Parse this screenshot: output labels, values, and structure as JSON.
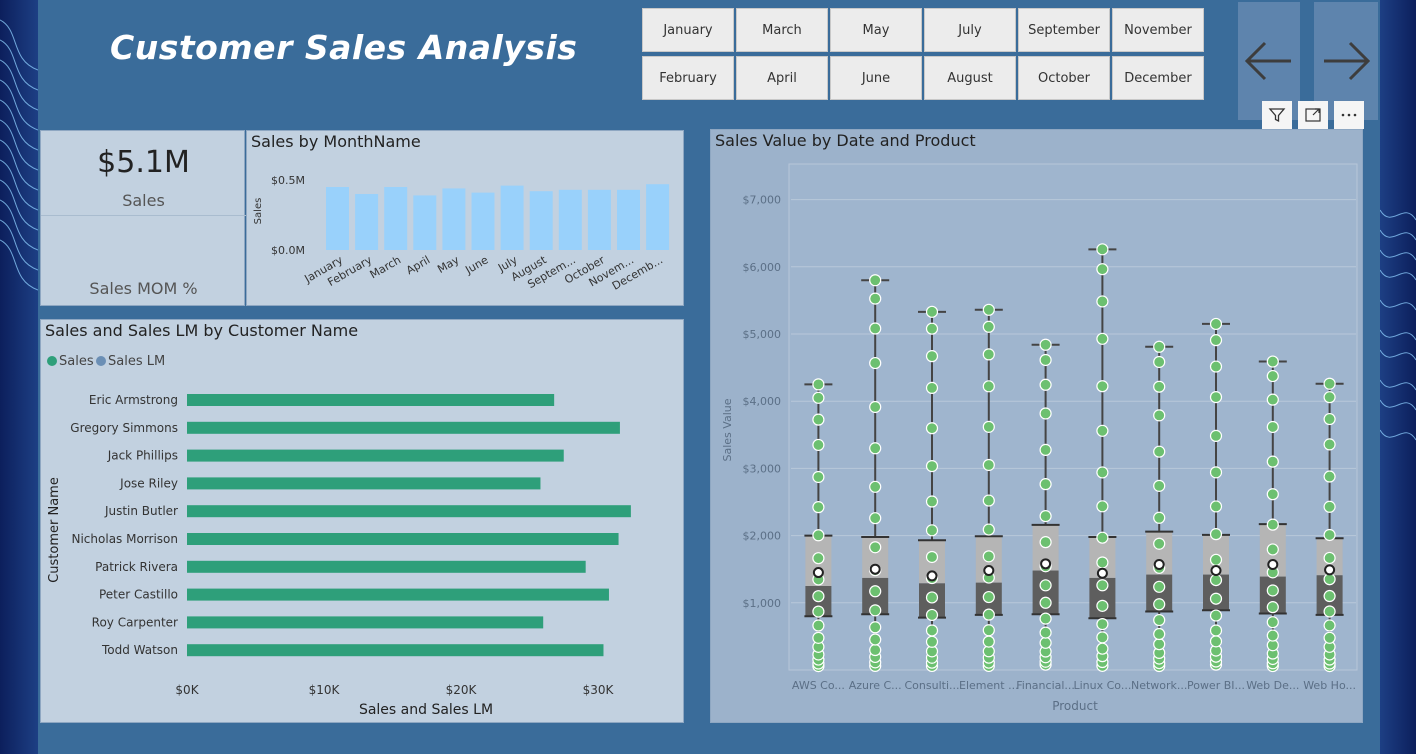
{
  "report": {
    "title": "Customer Sales Analysis"
  },
  "month_slicer": {
    "row1": [
      "January",
      "March",
      "May",
      "July",
      "September",
      "November"
    ],
    "row2": [
      "February",
      "April",
      "June",
      "August",
      "October",
      "December"
    ]
  },
  "navigation": {
    "prev_icon": "arrow-left-icon",
    "next_icon": "arrow-right-icon"
  },
  "visual_header_icons": [
    "filter-icon",
    "focus-mode-icon",
    "more-options-icon"
  ],
  "kpi_card": {
    "value": "$5.1M",
    "label": "Sales",
    "secondary_label": "Sales MOM %"
  },
  "colors": {
    "page_bg": "#3a6c9a",
    "panel_bg": "#c2d1e0",
    "month_bar": "#99d1fb",
    "sales_bar": "#2e9f7a",
    "sales_lm": "#6b8fb5",
    "box_dot": "#6cc070"
  },
  "charts": [
    {
      "id": "sales-by-month",
      "chart_data": {
        "type": "bar",
        "title": "Sales by MonthName",
        "ylabel": "Sales",
        "xlabel": "",
        "yticks": [
          "$0.0M",
          "$0.5M"
        ],
        "ylim": [
          0,
          0.5
        ],
        "categories": [
          "January",
          "February",
          "March",
          "April",
          "May",
          "June",
          "July",
          "August",
          "Septem...",
          "October",
          "Novem...",
          "Decemb..."
        ],
        "values": [
          0.45,
          0.4,
          0.45,
          0.39,
          0.44,
          0.41,
          0.46,
          0.42,
          0.43,
          0.43,
          0.43,
          0.47
        ]
      }
    },
    {
      "id": "sales-by-customer",
      "chart_data": {
        "type": "bar",
        "orientation": "horizontal",
        "title": "Sales and Sales LM by Customer Name",
        "xlabel": "Sales and Sales LM",
        "ylabel": "Customer Name",
        "legend": [
          "Sales",
          "Sales LM"
        ],
        "xticks": [
          "$0K",
          "$10K",
          "$20K",
          "$30K"
        ],
        "xlim": [
          0,
          35000
        ],
        "categories": [
          "Eric Armstrong",
          "Gregory Simmons",
          "Jack Phillips",
          "Jose Riley",
          "Justin Butler",
          "Nicholas Morrison",
          "Patrick Rivera",
          "Peter Castillo",
          "Roy Carpenter",
          "Todd Watson"
        ],
        "series": [
          {
            "name": "Sales",
            "values": [
              26800,
              31600,
              27500,
              25800,
              32400,
              31500,
              29100,
              30800,
              26000,
              30400
            ]
          }
        ]
      }
    },
    {
      "id": "sales-value-box",
      "chart_data": {
        "type": "box",
        "title": "Sales Value by Date and Product",
        "xlabel": "Product",
        "ylabel": "Sales Value",
        "yticks": [
          "$1,000",
          "$2,000",
          "$3,000",
          "$4,000",
          "$5,000",
          "$6,000",
          "$7,000"
        ],
        "ylim": [
          0,
          7500
        ],
        "categories": [
          "AWS Co...",
          "Azure C...",
          "Consulti...",
          "Element ...",
          "Financial...",
          "Linux Co...",
          "Network...",
          "Power BI...",
          "Web De...",
          "Web Ho..."
        ],
        "stats": [
          {
            "min": 50,
            "q1": 800,
            "median": 1250,
            "q3": 2000,
            "max": 4250,
            "mean": 1450
          },
          {
            "min": 50,
            "q1": 830,
            "median": 1370,
            "q3": 1980,
            "max": 5800,
            "mean": 1500
          },
          {
            "min": 50,
            "q1": 780,
            "median": 1290,
            "q3": 1930,
            "max": 5330,
            "mean": 1400
          },
          {
            "min": 50,
            "q1": 820,
            "median": 1300,
            "q3": 1990,
            "max": 5360,
            "mean": 1480
          },
          {
            "min": 70,
            "q1": 830,
            "median": 1480,
            "q3": 2160,
            "max": 4840,
            "mean": 1580
          },
          {
            "min": 50,
            "q1": 770,
            "median": 1370,
            "q3": 1980,
            "max": 6260,
            "mean": 1440
          },
          {
            "min": 50,
            "q1": 870,
            "median": 1420,
            "q3": 2060,
            "max": 4810,
            "mean": 1570
          },
          {
            "min": 70,
            "q1": 890,
            "median": 1420,
            "q3": 2010,
            "max": 5150,
            "mean": 1480
          },
          {
            "min": 50,
            "q1": 840,
            "median": 1390,
            "q3": 2170,
            "max": 4590,
            "mean": 1570
          },
          {
            "min": 50,
            "q1": 820,
            "median": 1410,
            "q3": 1960,
            "max": 4260,
            "mean": 1490
          }
        ]
      }
    }
  ]
}
